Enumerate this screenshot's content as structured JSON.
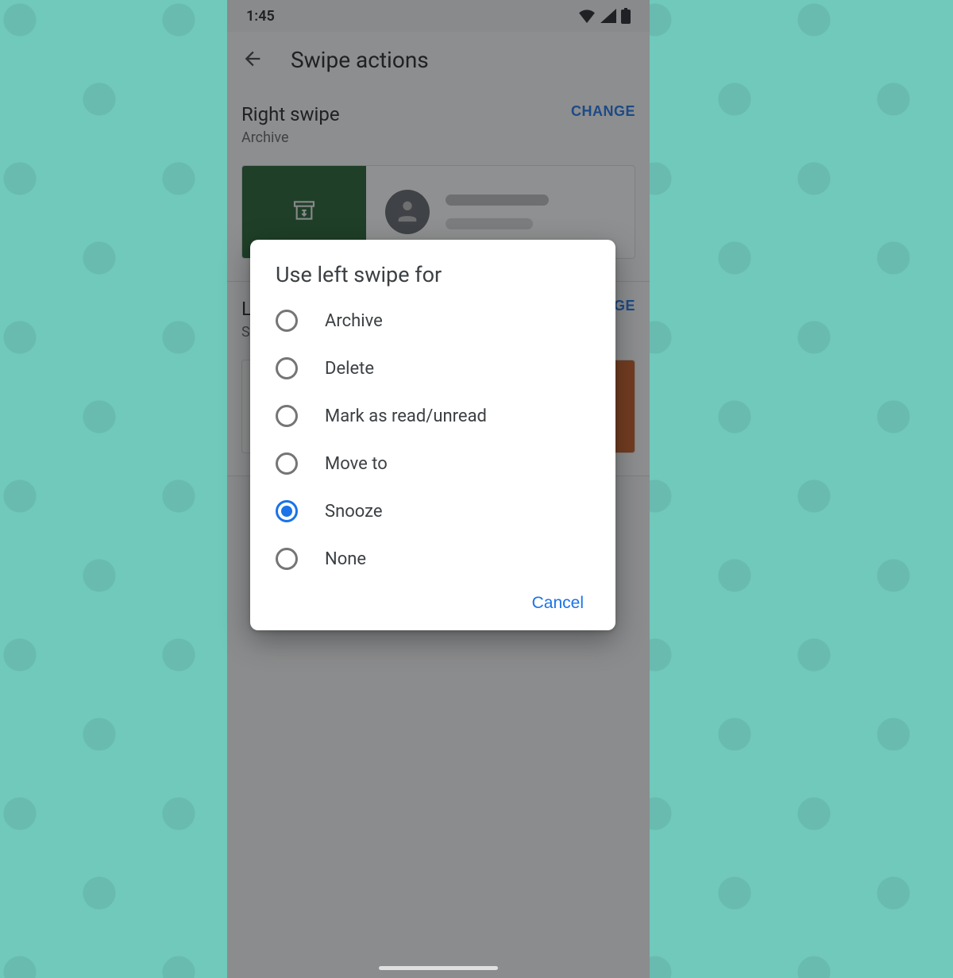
{
  "status": {
    "time": "1:45"
  },
  "appbar": {
    "title": "Swipe actions"
  },
  "sections": {
    "right": {
      "title": "Right swipe",
      "value": "Archive",
      "change": "CHANGE"
    },
    "left": {
      "title": "Left swipe",
      "value": "Snooze",
      "change": "CHANGE"
    }
  },
  "dialog": {
    "title": "Use left swipe for",
    "selected": "Snooze",
    "options": [
      {
        "label": "Archive"
      },
      {
        "label": "Delete"
      },
      {
        "label": "Mark as read/unread"
      },
      {
        "label": "Move to"
      },
      {
        "label": "Snooze"
      },
      {
        "label": "None"
      }
    ],
    "cancel": "Cancel"
  }
}
